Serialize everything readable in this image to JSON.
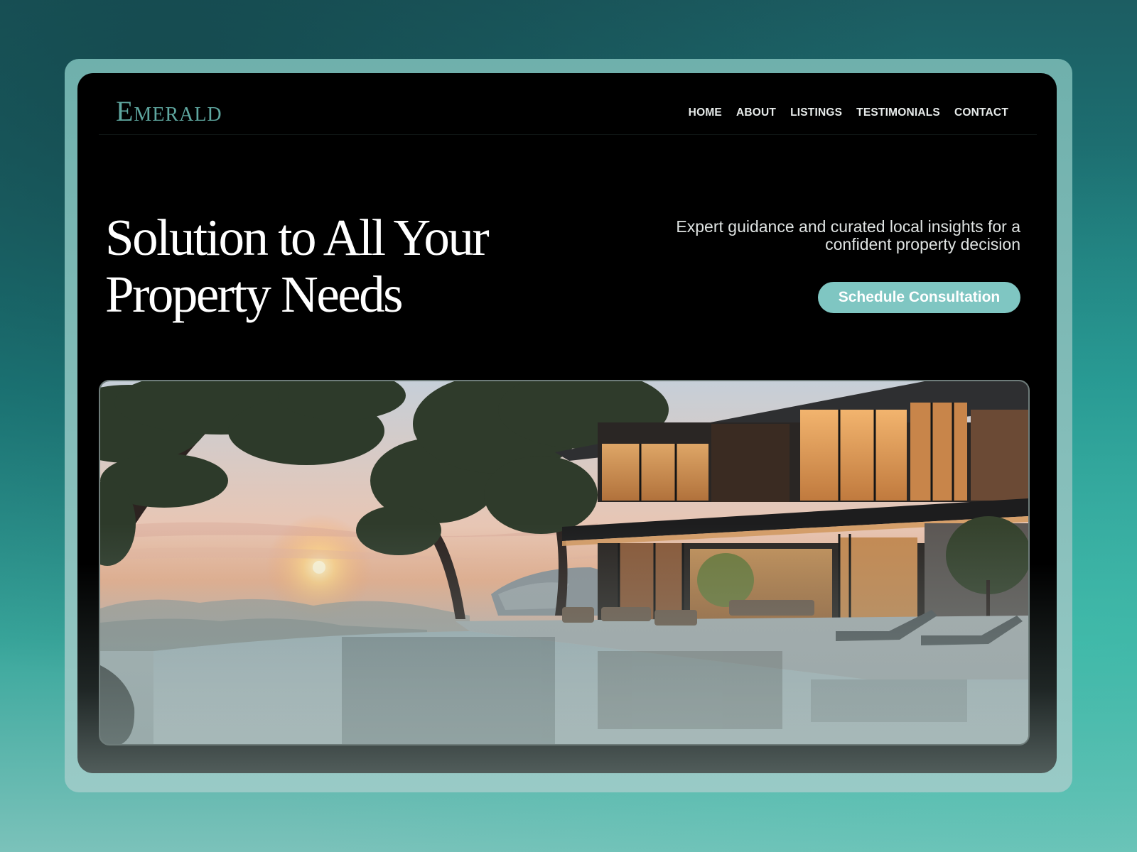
{
  "brand": {
    "logo_text": "Emerald"
  },
  "nav": {
    "items": [
      {
        "label": "HOME"
      },
      {
        "label": "ABOUT"
      },
      {
        "label": "LISTINGS"
      },
      {
        "label": "TESTIMONIALS"
      },
      {
        "label": "CONTACT"
      }
    ]
  },
  "hero": {
    "title_line1": "Solution to All Your",
    "title_line2": "Property Needs",
    "subtitle_line1": "Expert guidance and curated local insights for a",
    "subtitle_line2": "confident property decision",
    "cta_label": "Schedule Consultation"
  },
  "colors": {
    "accent": "#7fc6c2",
    "logo": "#5fa7a0",
    "page_background": "#000000",
    "backdrop": "#1e8a88"
  },
  "icons": []
}
